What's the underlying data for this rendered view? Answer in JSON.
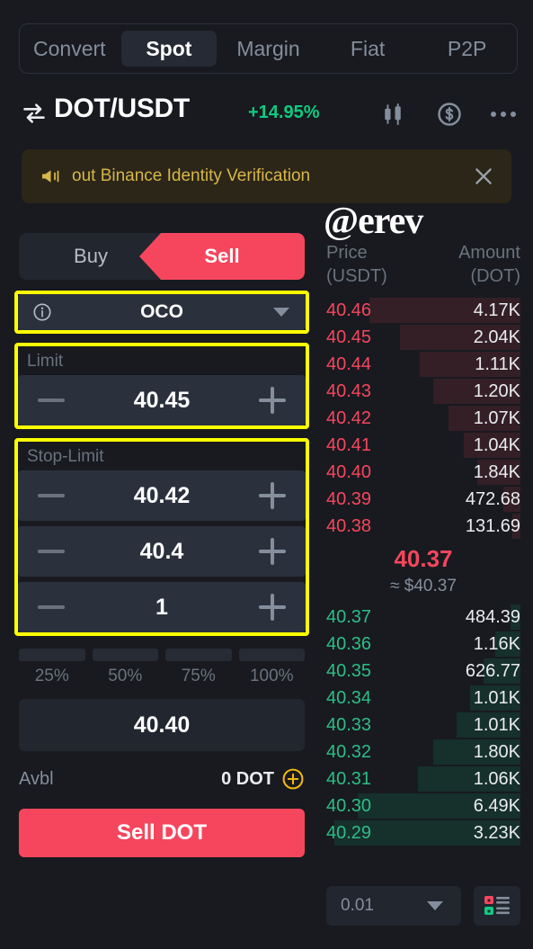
{
  "tabs": [
    {
      "label": "Convert",
      "active": false
    },
    {
      "label": "Spot",
      "active": true
    },
    {
      "label": "Margin",
      "active": false
    },
    {
      "label": "Fiat",
      "active": false
    },
    {
      "label": "P2P",
      "active": false
    }
  ],
  "header": {
    "pair": "DOT/USDT",
    "change": "+14.95%",
    "change_color": "#0ecb81",
    "swap_icon": "swap-arrows-icon",
    "chart_icon": "candlestick-chart-icon",
    "funds_icon": "dollar-circle-icon",
    "more_icon": "more-options-icon"
  },
  "banner": {
    "icon": "megaphone-icon",
    "text": "out Binance Identity Verification",
    "close_icon": "close-icon"
  },
  "watermark": "@erev",
  "order_form": {
    "buy_label": "Buy",
    "sell_label": "Sell",
    "side_active": "Sell",
    "order_type": "OCO",
    "info_icon": "info-icon",
    "dropdown_icon": "chevron-down-icon",
    "limit_label": "Limit",
    "limit_value": "40.45",
    "stop_limit_label": "Stop-Limit",
    "stop_value": "40.42",
    "stop_limit_value": "40.4",
    "quantity_value": "1",
    "percents": [
      "25%",
      "50%",
      "75%",
      "100%"
    ],
    "total_value": "40.40",
    "available_label": "Avbl",
    "available_value": "0 DOT",
    "add_funds_icon": "plus-circle-icon",
    "submit_label": "Sell DOT",
    "submit_color": "#f6465d"
  },
  "orderbook": {
    "col_price": "Price",
    "col_price_unit": "(USDT)",
    "col_amount": "Amount",
    "col_amount_unit": "(DOT)",
    "asks": [
      {
        "price": "40.46",
        "amount": "4.17K",
        "depth": 78
      },
      {
        "price": "40.45",
        "amount": "2.04K",
        "depth": 62
      },
      {
        "price": "40.44",
        "amount": "1.11K",
        "depth": 52
      },
      {
        "price": "40.43",
        "amount": "1.20K",
        "depth": 45
      },
      {
        "price": "40.42",
        "amount": "1.07K",
        "depth": 37
      },
      {
        "price": "40.41",
        "amount": "1.04K",
        "depth": 29
      },
      {
        "price": "40.40",
        "amount": "1.84K",
        "depth": 22
      },
      {
        "price": "40.39",
        "amount": "472.68",
        "depth": 9
      },
      {
        "price": "40.38",
        "amount": "131.69",
        "depth": 4
      }
    ],
    "last_price": "40.37",
    "last_price_color": "#f6465d",
    "last_price_usd": "≈ $40.37",
    "bids": [
      {
        "price": "40.37",
        "amount": "484.39",
        "depth": 5
      },
      {
        "price": "40.36",
        "amount": "1.16K",
        "depth": 13
      },
      {
        "price": "40.35",
        "amount": "626.77",
        "depth": 19
      },
      {
        "price": "40.34",
        "amount": "1.01K",
        "depth": 26
      },
      {
        "price": "40.33",
        "amount": "1.01K",
        "depth": 33
      },
      {
        "price": "40.32",
        "amount": "1.80K",
        "depth": 45
      },
      {
        "price": "40.31",
        "amount": "1.06K",
        "depth": 53
      },
      {
        "price": "40.30",
        "amount": "6.49K",
        "depth": 84
      },
      {
        "price": "40.29",
        "amount": "3.23K",
        "depth": 96
      }
    ],
    "tick_size": "0.01",
    "tick_icon": "chevron-down-icon",
    "view_icon": "orderbook-view-icon"
  }
}
